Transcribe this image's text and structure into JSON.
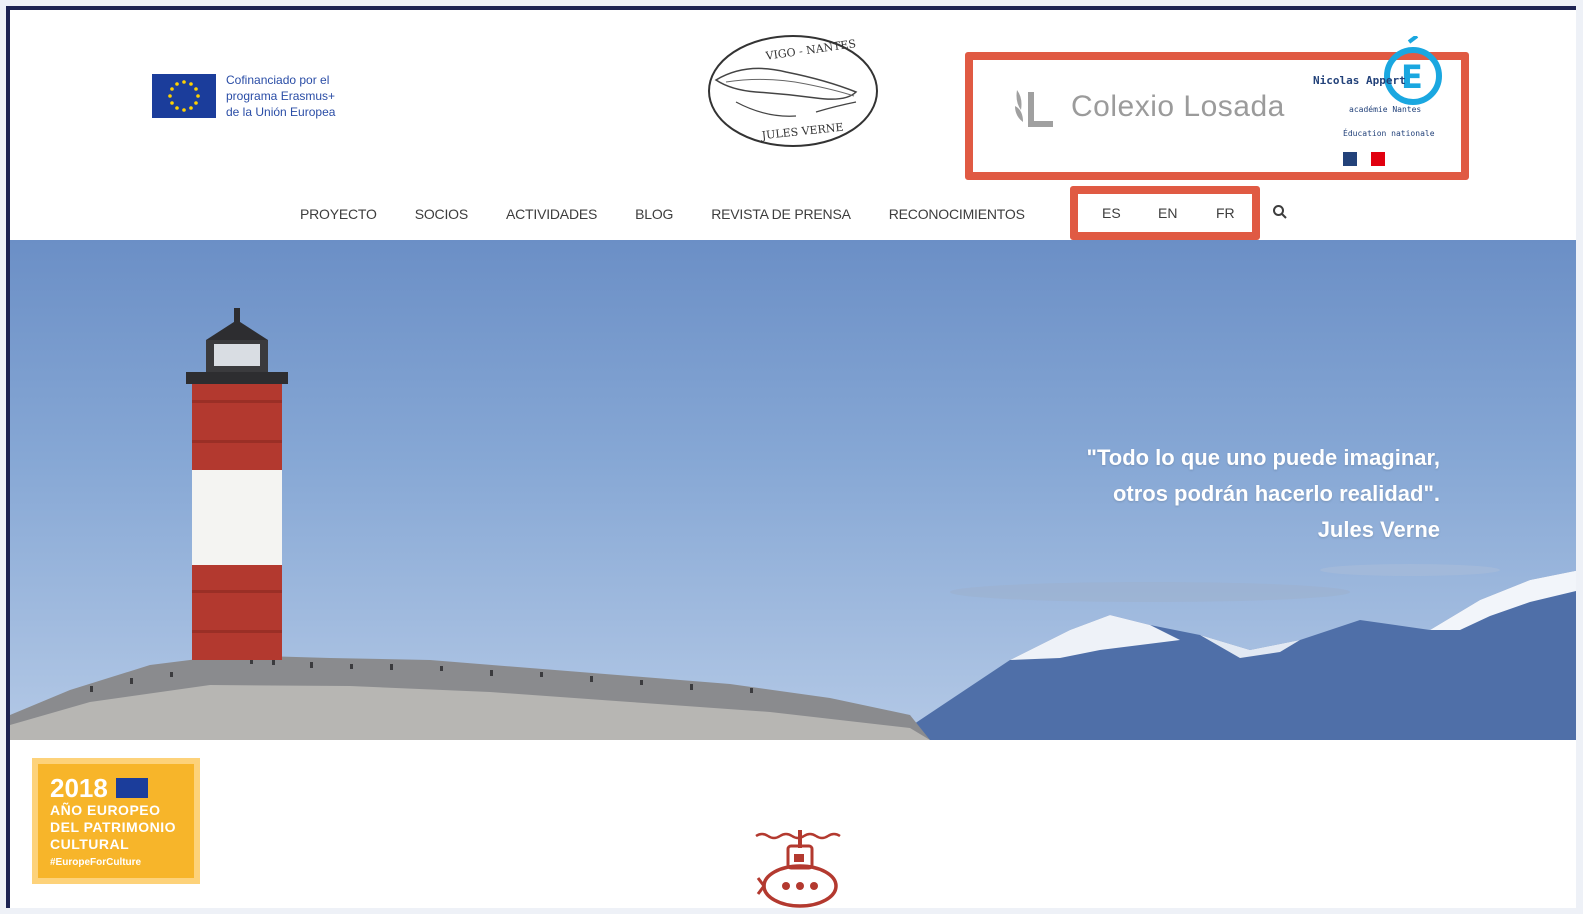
{
  "header": {
    "eu_logo": {
      "lines": [
        "Cofinanciado por el",
        "programa Erasmus+",
        "de la Unión Europea"
      ]
    },
    "seal": {
      "top_text": "VIGO - NANTES",
      "bottom_text": "JULES VERNE"
    },
    "partners": {
      "losada_name": "Colexio Losada",
      "appert_label": "Nicolas Appert",
      "academie": "académie Nantes",
      "education": "Éducation nationale"
    }
  },
  "nav": {
    "items": [
      "PROYECTO",
      "SOCIOS",
      "ACTIVIDADES",
      "BLOG",
      "REVISTA DE PRENSA",
      "RECONOCIMIENTOS"
    ],
    "languages": [
      "ES",
      "EN",
      "FR"
    ]
  },
  "hero": {
    "quote_lines": [
      "\"Todo lo que uno puede imaginar,",
      "otros podrán hacerlo realidad\".",
      "Jules Verne"
    ]
  },
  "badge": {
    "year": "2018",
    "lines": [
      "AÑO EUROPEO",
      "DEL PATRIMONIO",
      "CULTURAL"
    ],
    "tag": "#EuropeForCulture"
  },
  "colors": {
    "highlight": "#e05a43",
    "eu_blue": "#1b3d9b",
    "badge_yellow": "#f7b52a"
  }
}
